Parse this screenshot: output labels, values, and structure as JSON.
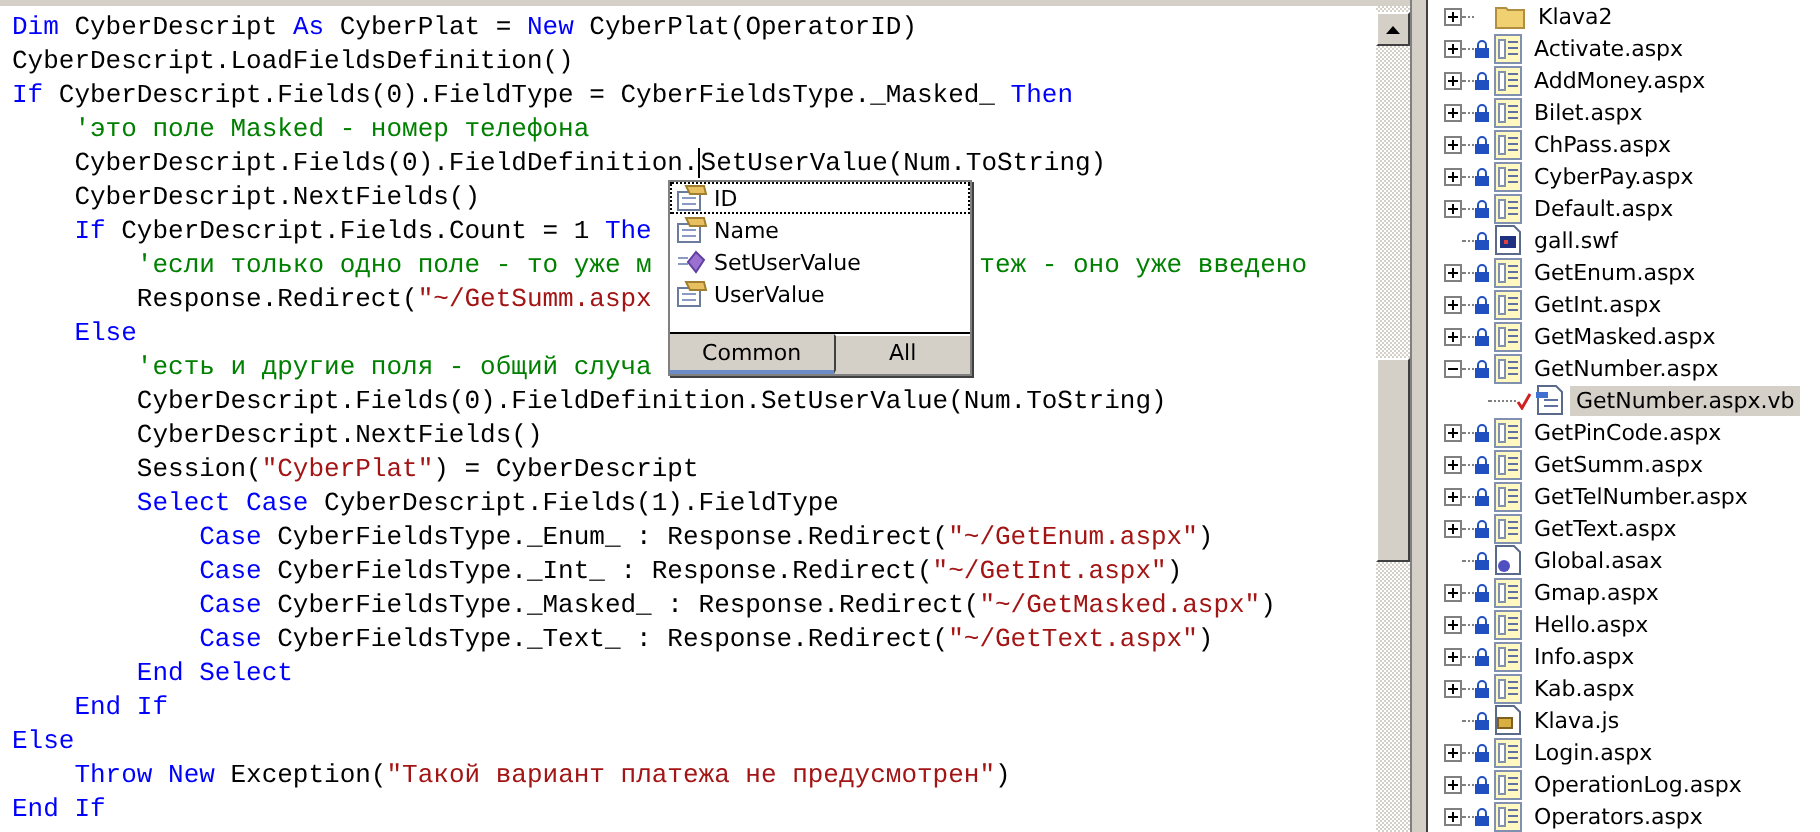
{
  "editor": {
    "lines": [
      {
        "tokens": [
          {
            "kind": "kw",
            "text": "Dim"
          },
          {
            "kind": "plain",
            "text": " CyberDescript "
          },
          {
            "kind": "kw",
            "text": "As"
          },
          {
            "kind": "plain",
            "text": " CyberPlat = "
          },
          {
            "kind": "kw",
            "text": "New"
          },
          {
            "kind": "plain",
            "text": " CyberPlat(OperatorID)"
          }
        ]
      },
      {
        "tokens": [
          {
            "kind": "plain",
            "text": "CyberDescript.LoadFieldsDefinition()"
          }
        ]
      },
      {
        "tokens": [
          {
            "kind": "kw",
            "text": "If"
          },
          {
            "kind": "plain",
            "text": " CyberDescript.Fields(0).FieldType = CyberFieldsType._Masked_ "
          },
          {
            "kind": "kw",
            "text": "Then"
          }
        ]
      },
      {
        "tokens": [
          {
            "kind": "comment",
            "text": "    'это поле Masked - номер телефона"
          }
        ]
      },
      {
        "tokens": [
          {
            "kind": "plain",
            "text": "    CyberDescript.Fields(0).FieldDefinition."
          },
          {
            "kind": "cursor"
          },
          {
            "kind": "plain",
            "text": "SetUserValue(Num.ToString)"
          }
        ]
      },
      {
        "tokens": [
          {
            "kind": "plain",
            "text": "    CyberDescript.NextFields()"
          }
        ]
      },
      {
        "tokens": [
          {
            "kind": "kw",
            "text": "    If"
          },
          {
            "kind": "plain",
            "text": " CyberDescript.Fields.Count = 1 "
          },
          {
            "kind": "kw",
            "text": "The"
          }
        ]
      },
      {
        "tokens": [
          {
            "kind": "comment",
            "text": "        'если только одно поле - то уже м"
          }
        ],
        "after": [
          {
            "kind": "comment",
            "text": "теж - оно уже введено"
          }
        ]
      },
      {
        "tokens": [
          {
            "kind": "plain",
            "text": "        Response.Redirect("
          },
          {
            "kind": "str",
            "text": "\"~/GetSumm.aspx"
          }
        ]
      },
      {
        "tokens": [
          {
            "kind": "kw",
            "text": "    Else"
          }
        ]
      },
      {
        "tokens": [
          {
            "kind": "comment",
            "text": "        'есть и другие поля - общий случа"
          }
        ]
      },
      {
        "tokens": [
          {
            "kind": "plain",
            "text": "        CyberDescript.Fields(0).FieldDefinition.SetUserValue(Num.ToString)"
          }
        ]
      },
      {
        "tokens": [
          {
            "kind": "plain",
            "text": "        CyberDescript.NextFields()"
          }
        ]
      },
      {
        "tokens": [
          {
            "kind": "plain",
            "text": "        Session("
          },
          {
            "kind": "str",
            "text": "\"CyberPlat\""
          },
          {
            "kind": "plain",
            "text": ") = CyberDescript"
          }
        ]
      },
      {
        "tokens": [
          {
            "kind": "kw",
            "text": "        Select Case"
          },
          {
            "kind": "plain",
            "text": " CyberDescript.Fields(1).FieldType"
          }
        ]
      },
      {
        "tokens": [
          {
            "kind": "kw",
            "text": "            Case"
          },
          {
            "kind": "plain",
            "text": " CyberFieldsType._Enum_ : Response.Redirect("
          },
          {
            "kind": "str",
            "text": "\"~/GetEnum.aspx\""
          },
          {
            "kind": "plain",
            "text": ")"
          }
        ]
      },
      {
        "tokens": [
          {
            "kind": "kw",
            "text": "            Case"
          },
          {
            "kind": "plain",
            "text": " CyberFieldsType._Int_ : Response.Redirect("
          },
          {
            "kind": "str",
            "text": "\"~/GetInt.aspx\""
          },
          {
            "kind": "plain",
            "text": ")"
          }
        ]
      },
      {
        "tokens": [
          {
            "kind": "kw",
            "text": "            Case"
          },
          {
            "kind": "plain",
            "text": " CyberFieldsType._Masked_ : Response.Redirect("
          },
          {
            "kind": "str",
            "text": "\"~/GetMasked.aspx\""
          },
          {
            "kind": "plain",
            "text": ")"
          }
        ]
      },
      {
        "tokens": [
          {
            "kind": "kw",
            "text": "            Case"
          },
          {
            "kind": "plain",
            "text": " CyberFieldsType._Text_ : Response.Redirect("
          },
          {
            "kind": "str",
            "text": "\"~/GetText.aspx\""
          },
          {
            "kind": "plain",
            "text": ")"
          }
        ]
      },
      {
        "tokens": [
          {
            "kind": "kw",
            "text": "        End Select"
          }
        ]
      },
      {
        "tokens": [
          {
            "kind": "kw",
            "text": "    End If"
          }
        ]
      },
      {
        "tokens": [
          {
            "kind": "kw",
            "text": "Else"
          }
        ]
      },
      {
        "tokens": [
          {
            "kind": "kw",
            "text": "    Throw New"
          },
          {
            "kind": "plain",
            "text": " Exception("
          },
          {
            "kind": "str",
            "text": "\"Такой вариант платежа не предусмотрен\""
          },
          {
            "kind": "plain",
            "text": ")"
          }
        ]
      },
      {
        "tokens": [
          {
            "kind": "kw",
            "text": "End If"
          }
        ]
      }
    ]
  },
  "completion": {
    "items": [
      {
        "label": "ID",
        "kind": "property",
        "selected": true
      },
      {
        "label": "Name",
        "kind": "property",
        "selected": false
      },
      {
        "label": "SetUserValue",
        "kind": "method",
        "selected": false
      },
      {
        "label": "UserValue",
        "kind": "property",
        "selected": false
      }
    ],
    "tabs": [
      {
        "label": "Common",
        "selected": true
      },
      {
        "label": "All",
        "selected": false
      }
    ]
  },
  "solution_explorer": {
    "items": [
      {
        "label": "Klava2",
        "kind": "folder",
        "locked": false,
        "checked_out": false,
        "expanded": false,
        "selected": false
      },
      {
        "label": "Activate.aspx",
        "kind": "aspx",
        "locked": true,
        "checked_out": false,
        "expanded": false,
        "selected": false
      },
      {
        "label": "AddMoney.aspx",
        "kind": "aspx",
        "locked": true,
        "checked_out": false,
        "expanded": false,
        "selected": false
      },
      {
        "label": "Bilet.aspx",
        "kind": "aspx",
        "locked": true,
        "checked_out": false,
        "expanded": false,
        "selected": false
      },
      {
        "label": "ChPass.aspx",
        "kind": "aspx",
        "locked": true,
        "checked_out": false,
        "expanded": false,
        "selected": false
      },
      {
        "label": "CyberPay.aspx",
        "kind": "aspx",
        "locked": true,
        "checked_out": false,
        "expanded": false,
        "selected": false
      },
      {
        "label": "Default.aspx",
        "kind": "aspx",
        "locked": true,
        "checked_out": false,
        "expanded": false,
        "selected": false
      },
      {
        "label": "gall.swf",
        "kind": "swf",
        "locked": true,
        "checked_out": false,
        "selected": false
      },
      {
        "label": "GetEnum.aspx",
        "kind": "aspx",
        "locked": true,
        "checked_out": false,
        "expanded": false,
        "selected": false
      },
      {
        "label": "GetInt.aspx",
        "kind": "aspx",
        "locked": true,
        "checked_out": false,
        "expanded": false,
        "selected": false
      },
      {
        "label": "GetMasked.aspx",
        "kind": "aspx",
        "locked": true,
        "checked_out": false,
        "expanded": false,
        "selected": false
      },
      {
        "label": "GetNumber.aspx",
        "kind": "aspx",
        "locked": true,
        "checked_out": false,
        "expanded": true,
        "selected": false,
        "children": [
          {
            "label": "GetNumber.aspx.vb",
            "kind": "vb",
            "locked": false,
            "checked_out": true,
            "selected": true
          }
        ]
      },
      {
        "label": "GetPinCode.aspx",
        "kind": "aspx",
        "locked": true,
        "checked_out": false,
        "expanded": false,
        "selected": false
      },
      {
        "label": "GetSumm.aspx",
        "kind": "aspx",
        "locked": true,
        "checked_out": false,
        "expanded": false,
        "selected": false
      },
      {
        "label": "GetTelNumber.aspx",
        "kind": "aspx",
        "locked": true,
        "checked_out": false,
        "expanded": false,
        "selected": false
      },
      {
        "label": "GetText.aspx",
        "kind": "aspx",
        "locked": true,
        "checked_out": false,
        "expanded": false,
        "selected": false
      },
      {
        "label": "Global.asax",
        "kind": "asax",
        "locked": true,
        "checked_out": false,
        "selected": false
      },
      {
        "label": "Gmap.aspx",
        "kind": "aspx",
        "locked": true,
        "checked_out": false,
        "expanded": false,
        "selected": false
      },
      {
        "label": "Hello.aspx",
        "kind": "aspx",
        "locked": true,
        "checked_out": false,
        "expanded": false,
        "selected": false
      },
      {
        "label": "Info.aspx",
        "kind": "aspx",
        "locked": true,
        "checked_out": false,
        "expanded": false,
        "selected": false
      },
      {
        "label": "Kab.aspx",
        "kind": "aspx",
        "locked": true,
        "checked_out": false,
        "expanded": false,
        "selected": false
      },
      {
        "label": "Klava.js",
        "kind": "js",
        "locked": true,
        "checked_out": false,
        "selected": false
      },
      {
        "label": "Login.aspx",
        "kind": "aspx",
        "locked": true,
        "checked_out": false,
        "expanded": false,
        "selected": false
      },
      {
        "label": "OperationLog.aspx",
        "kind": "aspx",
        "locked": true,
        "checked_out": false,
        "expanded": false,
        "selected": false
      },
      {
        "label": "Operators.aspx",
        "kind": "aspx",
        "locked": true,
        "checked_out": false,
        "expanded": false,
        "selected": false
      }
    ]
  }
}
